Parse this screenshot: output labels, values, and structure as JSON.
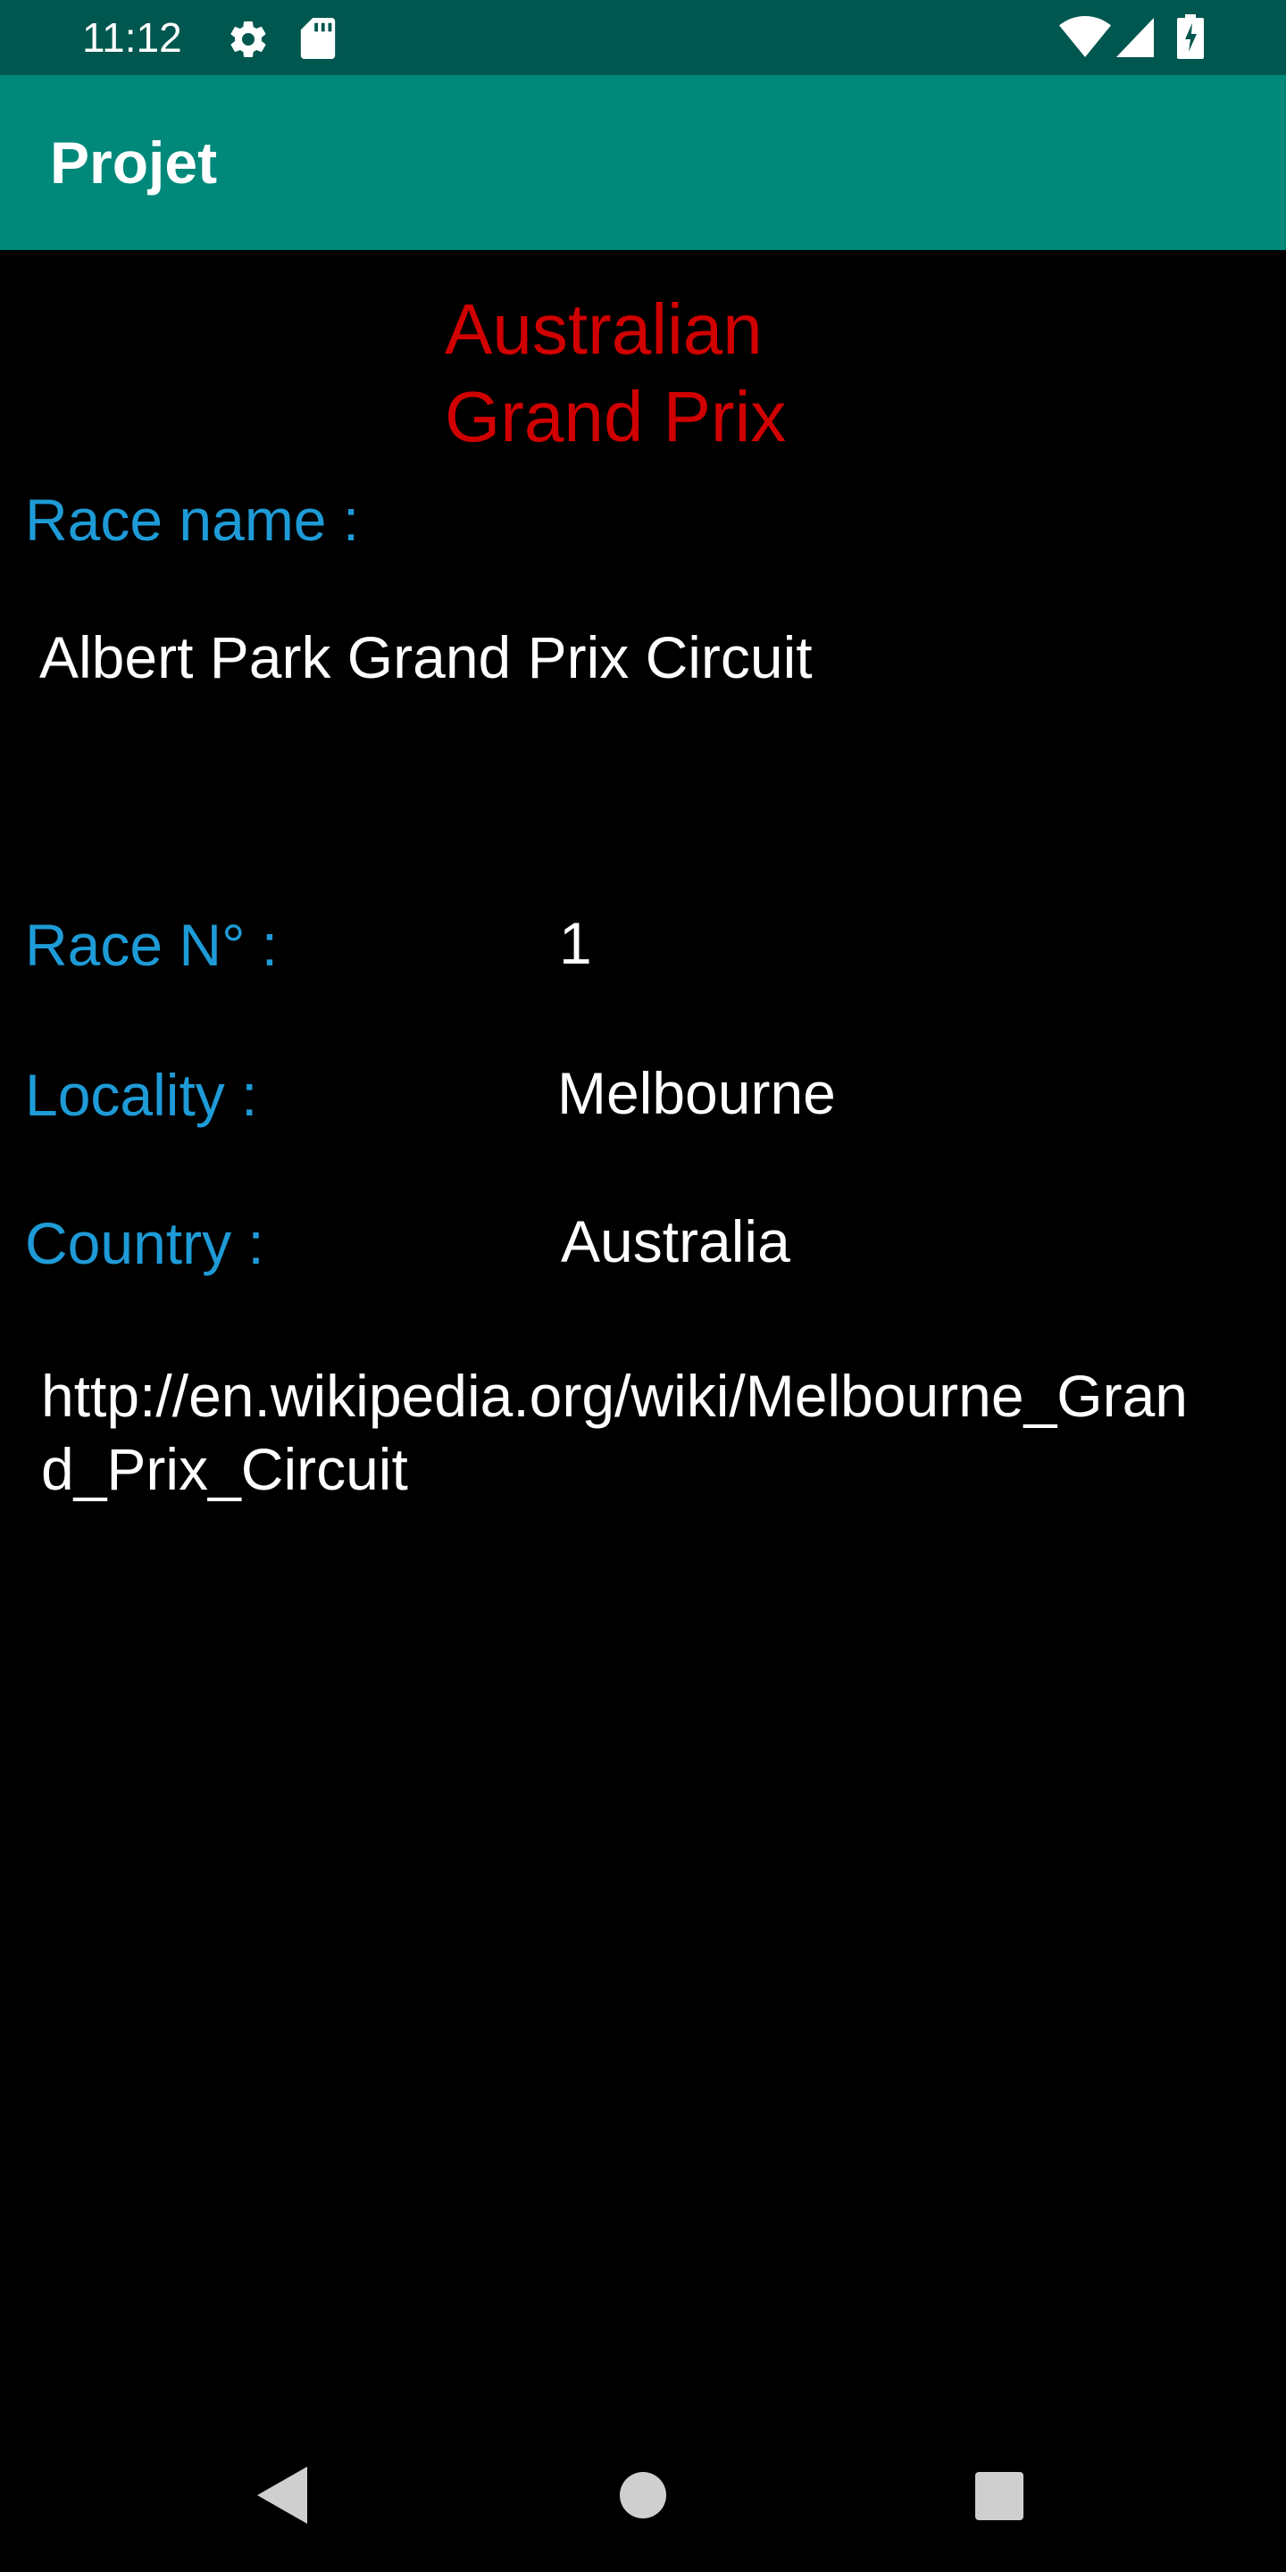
{
  "status_bar": {
    "time": "11:12",
    "icons": [
      "settings-icon",
      "sd-card-icon",
      "wifi-icon",
      "signal-icon",
      "battery-icon"
    ],
    "background": "#00574f"
  },
  "app_bar": {
    "title": "Projet",
    "background": "#00897b"
  },
  "race": {
    "title_line1": "Australian",
    "title_line2": "Grand Prix",
    "title_color": "#d00000",
    "race_name_label": "Race name :",
    "race_name_value": "Albert Park Grand Prix Circuit",
    "race_number_label": "Race N° :",
    "race_number_value": "1",
    "locality_label": "Locality :",
    "locality_value": "Melbourne",
    "country_label": "Country :",
    "country_value": "Australia",
    "url": "http://en.wikipedia.org/wiki/Melbourne_Grand_Prix_Circuit",
    "label_color": "#1e9bd7"
  },
  "nav_bar": {
    "buttons": [
      "back-icon",
      "home-icon",
      "recents-icon"
    ]
  }
}
